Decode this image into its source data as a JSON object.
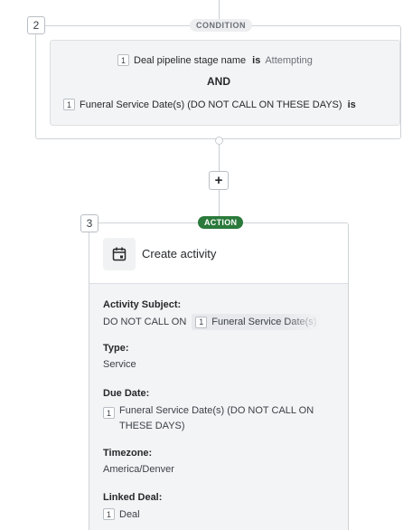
{
  "condition_step": {
    "number": "2",
    "badge": "CONDITION",
    "rule1": {
      "token": "1",
      "field": "Deal pipeline stage name",
      "operator": "is",
      "value": "Attempting"
    },
    "joiner": "AND",
    "rule2": {
      "token": "1",
      "field": "Funeral Service Date(s) (DO NOT CALL ON THESE DAYS)",
      "operator": "is"
    }
  },
  "add_step_label": "+",
  "action_step": {
    "number": "3",
    "badge": "ACTION",
    "title": "Create activity",
    "icon": "calendar-icon",
    "fields": {
      "subject": {
        "label": "Activity Subject:",
        "prefix": "DO NOT CALL ON",
        "token": "1",
        "chip": "Funeral Service Date(s)"
      },
      "type": {
        "label": "Type:",
        "value": "Service"
      },
      "due_date": {
        "label": "Due Date:",
        "token": "1",
        "line1": "Funeral Service Date(s) (DO NOT CALL ON",
        "line2": "THESE DAYS)"
      },
      "timezone": {
        "label": "Timezone:",
        "value": "America/Denver"
      },
      "linked_deal": {
        "label": "Linked Deal:",
        "token": "1",
        "value": "Deal"
      }
    }
  },
  "colors": {
    "action_badge": "#2b7a3b",
    "panel_bg": "#f3f4f6",
    "border": "#cfd3d7"
  }
}
